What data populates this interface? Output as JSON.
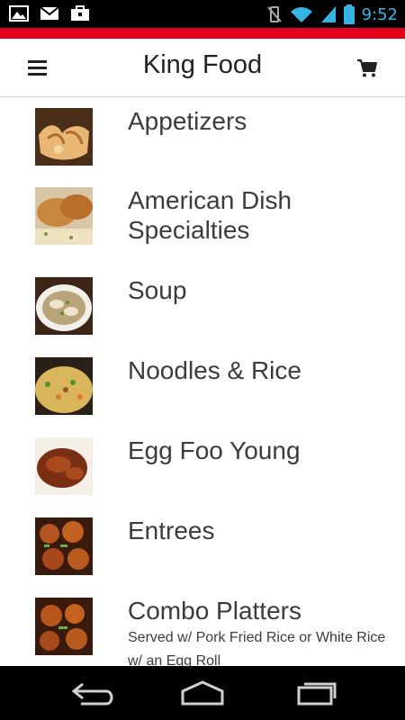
{
  "status_bar": {
    "time": "9:52"
  },
  "header": {
    "title": "King Food"
  },
  "menu": [
    {
      "title": "Appetizers",
      "subtitle": ""
    },
    {
      "title": "American Dish Specialties",
      "subtitle": ""
    },
    {
      "title": "Soup",
      "subtitle": ""
    },
    {
      "title": "Noodles & Rice",
      "subtitle": ""
    },
    {
      "title": "Egg Foo Young",
      "subtitle": ""
    },
    {
      "title": "Entrees",
      "subtitle": ""
    },
    {
      "title": "Combo Platters",
      "subtitle": "Served w/ Pork Fried Rice or White Rice w/ an Egg Roll"
    }
  ],
  "colors": {
    "accent": "#e3001b",
    "time": "#33b5e5"
  }
}
